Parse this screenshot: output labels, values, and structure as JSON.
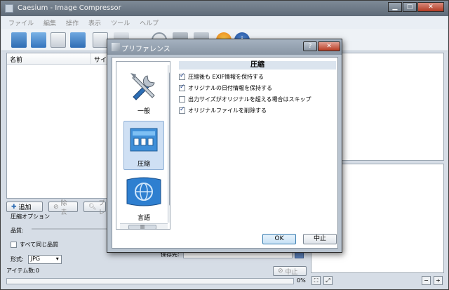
{
  "window": {
    "title": "Caesium - Image Compressor",
    "buttons": {
      "minimize": "▁",
      "maximize": "□",
      "close": "✕"
    }
  },
  "menu": [
    "ファイル",
    "編集",
    "操作",
    "表示",
    "ツール",
    "ヘルプ"
  ],
  "list": {
    "col_name": "名前",
    "col_size": "サイ"
  },
  "actions": {
    "add": "追加",
    "remove": "除去",
    "preview": "プレ"
  },
  "compression_group": {
    "legend": "圧縮オプション",
    "quality_label": "品質:",
    "same_quality_label": "すべて同じ品質",
    "same_quality_checked": false,
    "format_label": "形式:",
    "format_value": "JPG"
  },
  "output": {
    "label": "保存先:"
  },
  "status": {
    "item_count": "アイテム数:0",
    "cancel": "中止",
    "progress_text": "0%",
    "progress_value": 0
  },
  "dialog": {
    "title": "プリファレンス",
    "help": "?",
    "close": "✕",
    "categories": [
      {
        "label": "一般",
        "icon": "tools-icon",
        "selected": false
      },
      {
        "label": "圧縮",
        "icon": "compression-icon",
        "selected": true
      },
      {
        "label": "言語",
        "icon": "language-icon",
        "selected": false
      }
    ],
    "section_title": "圧縮",
    "options": [
      {
        "label": "圧縮後も EXIF情報を保持する",
        "checked": true
      },
      {
        "label": "オリジナルの日付情報を保持する",
        "checked": true
      },
      {
        "label": "出力サイズがオリジナルを超える場合はスキップ",
        "checked": false
      },
      {
        "label": "オリジナルファイルを削除する",
        "checked": true
      }
    ],
    "ok": "OK",
    "cancel": "中止"
  },
  "colors": {
    "accent": "#3c7fb1",
    "title_bar": "#6f7b88",
    "dialog_bg": "#b9c4d0"
  }
}
